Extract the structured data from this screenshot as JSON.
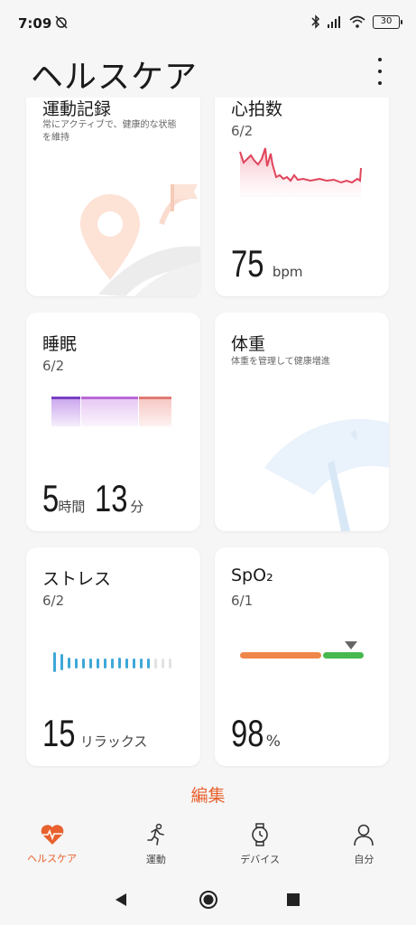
{
  "status": {
    "time": "7:09",
    "battery": "30"
  },
  "header": {
    "title": "ヘルスケア"
  },
  "cards": {
    "activity": {
      "title": "運動記録",
      "desc_line1": "常にアクティブで、健康的な状態",
      "desc_line2": "を維持"
    },
    "heart_rate": {
      "title": "心拍数",
      "date": "6/2",
      "value": "75",
      "unit": "bpm"
    },
    "sleep": {
      "title": "睡眠",
      "date": "6/2",
      "hours": "5",
      "hours_unit": "時間",
      "minutes": "13",
      "minutes_unit": "分"
    },
    "weight": {
      "title": "体重",
      "desc": "体重を管理して健康増進"
    },
    "stress": {
      "title": "ストレス",
      "date": "6/2",
      "value": "15",
      "level": "リラックス"
    },
    "spo2": {
      "title": "SpO₂",
      "date": "6/1",
      "value": "98",
      "unit": "%"
    }
  },
  "edit_label": "編集",
  "bottom_nav": [
    {
      "label": "ヘルスケア",
      "icon": "heart-pulse-icon",
      "active": true
    },
    {
      "label": "運動",
      "icon": "running-icon",
      "active": false
    },
    {
      "label": "デバイス",
      "icon": "watch-icon",
      "active": false
    },
    {
      "label": "自分",
      "icon": "person-icon",
      "active": false
    }
  ],
  "colors": {
    "accent": "#e8612e",
    "heart": "#e0455c",
    "sleep_deep": "#7b3fc4",
    "sleep_light": "#b86ad8",
    "sleep_rem": "#e07a74",
    "stress": "#3ea8d8",
    "spo2_low": "#f0874a",
    "spo2_ok": "#46b84e"
  }
}
